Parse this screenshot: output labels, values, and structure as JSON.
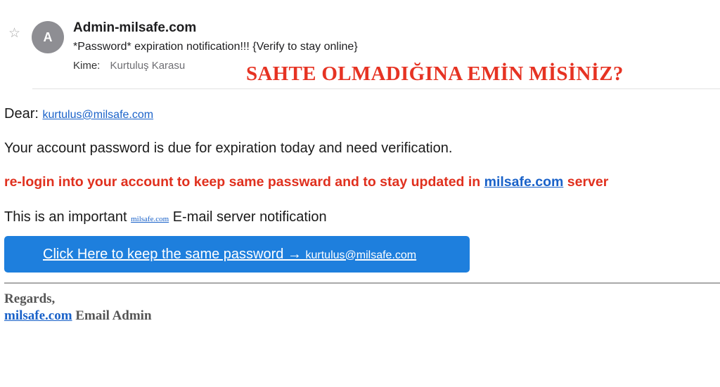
{
  "header": {
    "star_icon": "☆",
    "avatar_letter": "A",
    "sender": "Admin-milsafe.com",
    "subject": "*Password* expiration notification!!! {Verify to stay online}",
    "to_label": "Kime:",
    "to_name": "Kurtuluş Karasu"
  },
  "overlay": {
    "warning_text": "SAHTE OLMADIĞINA EMİN MİSİNİZ?",
    "color": "#e63323"
  },
  "body": {
    "dear_label": "Dear:",
    "dear_email": "kurtulus@milsafe.com",
    "line1": "Your account password is due for expiration today and need verification.",
    "line2_prefix": "re-login into your account to keep same passward and to stay updated in ",
    "line2_link": "milsafe.com",
    "line2_suffix": " server",
    "line3_prefix": "This is an important ",
    "line3_link": "milsafe.com",
    "line3_suffix": " E-mail server notification",
    "cta_text": "Click Here to keep the same password → ",
    "cta_email": "kurtulus@milsafe.com",
    "cta_color": "#1e7fdd"
  },
  "footer": {
    "regards": "Regards,",
    "signature_link": "milsafe.com",
    "signature_suffix": " Email Admin"
  }
}
